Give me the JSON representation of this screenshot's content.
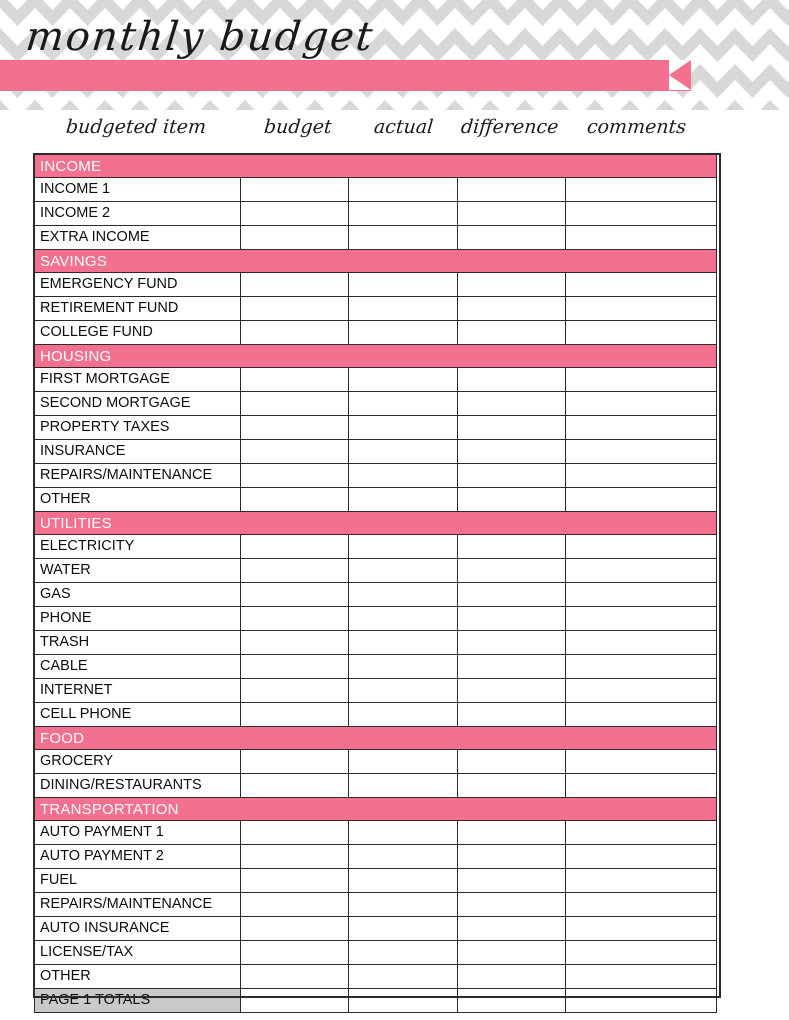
{
  "header": {
    "title": "monthly budget",
    "banner_color": "#f4708f",
    "chevron_gray": "#d8d8d8",
    "chevron_white": "#ffffff"
  },
  "columns": [
    {
      "label": "budgeted item"
    },
    {
      "label": "budget"
    },
    {
      "label": "actual"
    },
    {
      "label": "difference"
    },
    {
      "label": "comments"
    }
  ],
  "colors": {
    "section_bg": "#f4708f",
    "section_text": "#ffffff",
    "totals_bg": "#c9c9c9",
    "border": "#2b2b2b",
    "row_text": "#0d0d0d"
  },
  "sections": [
    {
      "title": "INCOME",
      "rows": [
        {
          "label": "INCOME 1",
          "budget": "",
          "actual": "",
          "difference": "",
          "comments": ""
        },
        {
          "label": "INCOME 2",
          "budget": "",
          "actual": "",
          "difference": "",
          "comments": ""
        },
        {
          "label": "EXTRA INCOME",
          "budget": "",
          "actual": "",
          "difference": "",
          "comments": ""
        }
      ]
    },
    {
      "title": "SAVINGS",
      "rows": [
        {
          "label": "EMERGENCY FUND",
          "budget": "",
          "actual": "",
          "difference": "",
          "comments": ""
        },
        {
          "label": "RETIREMENT FUND",
          "budget": "",
          "actual": "",
          "difference": "",
          "comments": ""
        },
        {
          "label": "COLLEGE FUND",
          "budget": "",
          "actual": "",
          "difference": "",
          "comments": ""
        }
      ]
    },
    {
      "title": "HOUSING",
      "rows": [
        {
          "label": "FIRST MORTGAGE",
          "budget": "",
          "actual": "",
          "difference": "",
          "comments": ""
        },
        {
          "label": "SECOND MORTGAGE",
          "budget": "",
          "actual": "",
          "difference": "",
          "comments": ""
        },
        {
          "label": "PROPERTY TAXES",
          "budget": "",
          "actual": "",
          "difference": "",
          "comments": ""
        },
        {
          "label": "INSURANCE",
          "budget": "",
          "actual": "",
          "difference": "",
          "comments": ""
        },
        {
          "label": "REPAIRS/MAINTENANCE",
          "budget": "",
          "actual": "",
          "difference": "",
          "comments": ""
        },
        {
          "label": "OTHER",
          "budget": "",
          "actual": "",
          "difference": "",
          "comments": ""
        }
      ]
    },
    {
      "title": "UTILITIES",
      "rows": [
        {
          "label": "ELECTRICITY",
          "budget": "",
          "actual": "",
          "difference": "",
          "comments": ""
        },
        {
          "label": "WATER",
          "budget": "",
          "actual": "",
          "difference": "",
          "comments": ""
        },
        {
          "label": "GAS",
          "budget": "",
          "actual": "",
          "difference": "",
          "comments": ""
        },
        {
          "label": "PHONE",
          "budget": "",
          "actual": "",
          "difference": "",
          "comments": ""
        },
        {
          "label": "TRASH",
          "budget": "",
          "actual": "",
          "difference": "",
          "comments": ""
        },
        {
          "label": "CABLE",
          "budget": "",
          "actual": "",
          "difference": "",
          "comments": ""
        },
        {
          "label": "INTERNET",
          "budget": "",
          "actual": "",
          "difference": "",
          "comments": ""
        },
        {
          "label": "CELL PHONE",
          "budget": "",
          "actual": "",
          "difference": "",
          "comments": ""
        }
      ]
    },
    {
      "title": "FOOD",
      "rows": [
        {
          "label": "GROCERY",
          "budget": "",
          "actual": "",
          "difference": "",
          "comments": ""
        },
        {
          "label": "DINING/RESTAURANTS",
          "budget": "",
          "actual": "",
          "difference": "",
          "comments": ""
        }
      ]
    },
    {
      "title": "TRANSPORTATION",
      "rows": [
        {
          "label": "AUTO PAYMENT 1",
          "budget": "",
          "actual": "",
          "difference": "",
          "comments": ""
        },
        {
          "label": "AUTO PAYMENT 2",
          "budget": "",
          "actual": "",
          "difference": "",
          "comments": ""
        },
        {
          "label": "FUEL",
          "budget": "",
          "actual": "",
          "difference": "",
          "comments": ""
        },
        {
          "label": "REPAIRS/MAINTENANCE",
          "budget": "",
          "actual": "",
          "difference": "",
          "comments": ""
        },
        {
          "label": "AUTO INSURANCE",
          "budget": "",
          "actual": "",
          "difference": "",
          "comments": ""
        },
        {
          "label": "LICENSE/TAX",
          "budget": "",
          "actual": "",
          "difference": "",
          "comments": ""
        },
        {
          "label": "OTHER",
          "budget": "",
          "actual": "",
          "difference": "",
          "comments": ""
        }
      ]
    }
  ],
  "totals_row": {
    "label": "PAGE 1 TOTALS",
    "budget": "",
    "actual": "",
    "difference": "",
    "comments": ""
  }
}
